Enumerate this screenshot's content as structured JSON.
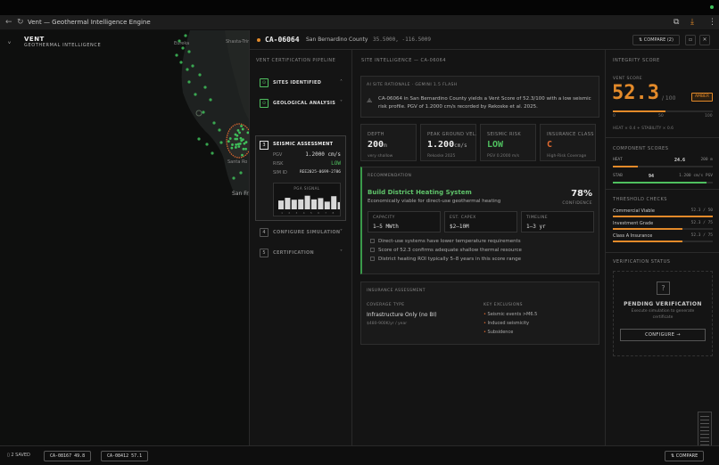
{
  "browser": {
    "title": "Vent — Geothermal Intelligence Engine"
  },
  "brand": {
    "name": "VENT",
    "subtitle": "GEOTHERMAL INTELLIGENCE"
  },
  "map": {
    "labels": [
      "Eureka",
      "Shasta-Trinity National Fore",
      "Santa Ro",
      "San Fr"
    ]
  },
  "site": {
    "id": "CA-06064",
    "county": "San Bernardino County",
    "coords": "35.5000, -116.5009",
    "compare_label": "COMPARE (2)"
  },
  "pipeline": {
    "header": "VENT CERTIFICATION PIPELINE",
    "steps": [
      {
        "label": "SITES IDENTIFIED"
      },
      {
        "label": "GEOLOGICAL ANALYSIS"
      },
      {
        "label": "SEISMIC ASSESSMENT",
        "num": "3"
      },
      {
        "label": "CONFIGURE SIMULATION",
        "num": "4"
      },
      {
        "label": "CERTIFICATION",
        "num": "5"
      }
    ],
    "seismic": {
      "pgv_label": "PGV",
      "pgv_value": "1.2000 cm/s",
      "risk_label": "RISK",
      "risk_value": "LOW",
      "sim_label": "SIM ID",
      "sim_value": "REE2025-0699-2786",
      "pga_title": "PGA SIGNAL",
      "pga_values": [
        0.55,
        0.72,
        0.6,
        0.62,
        0.85,
        0.62,
        0.7,
        0.48,
        0.82,
        0.45
      ],
      "pga_ticks": [
        "1",
        "2",
        "3",
        "4",
        "5",
        "6",
        "7",
        "8"
      ]
    }
  },
  "intel": {
    "header": "SITE INTELLIGENCE — CA-06064",
    "rationale_header": "AI SITE RATIONALE · GEMINI 1.5 FLASH",
    "rationale_text_1": "CA-06064 in San Bernardino County yields a Vent Score of 52.3/100 with a low seismic",
    "rationale_text_2": "risk profile. PGV of 1.2000 cm/s recorded by Rekoske et al. 2025.",
    "metrics": [
      {
        "label": "DEPTH",
        "value": "200",
        "unit": "m",
        "sub": "very shallow",
        "color": "#eeeeee"
      },
      {
        "label": "PEAK GROUND VEL.",
        "value": "1.200",
        "unit": "cm/s",
        "sub": "Rekoske 2025",
        "color": "#eeeeee"
      },
      {
        "label": "SEISMIC RISK",
        "value": "LOW",
        "unit": "",
        "sub": "PGV 0.2000 m/s",
        "color": "#4fbf5f"
      },
      {
        "label": "INSURANCE CLASS",
        "value": "C",
        "unit": "",
        "sub": "High-Risk Coverage",
        "color": "#e0692f"
      }
    ],
    "recommendation": {
      "header": "RECOMMENDATION",
      "title": "Build District Heating System",
      "subtitle": "Economically viable for direct-use geothermal heating",
      "confidence_value": "78%",
      "confidence_label": "CONFIDENCE",
      "stats": [
        {
          "label": "CAPACITY",
          "value": "1–5 MWth"
        },
        {
          "label": "EST. CAPEX",
          "value": "$2–10M"
        },
        {
          "label": "TIMELINE",
          "value": "1–3 yr"
        }
      ],
      "notes": [
        "Direct-use systems have lower temperature requirements",
        "Score of 52.3 confirms adequate shallow thermal resource",
        "District heating ROI typically 5–8 years in this score range"
      ]
    },
    "insurance": {
      "header": "INSURANCE ASSESSMENT",
      "coverage_label": "COVERAGE TYPE",
      "coverage_value": "Infrastructure Only (no BI)",
      "coverage_price": "$480-900K/yr / year",
      "exclusions_label": "KEY EXCLUSIONS",
      "exclusions": [
        "Seismic events >M6.5",
        "Induced seismicity",
        "Subsidence"
      ]
    }
  },
  "integrity": {
    "header": "INTEGRITY SCORE",
    "vent_score_label": "VENT SCORE",
    "score": "52.3",
    "score_fraction": 0.523,
    "score_max": "/ 100",
    "grade": "AMBER",
    "scale": [
      "0",
      "50",
      "100"
    ],
    "breakdown": "HEAT × 0.4 + STABILITY × 0.6",
    "components_header": "COMPONENT SCORES",
    "components": [
      {
        "label": "HEAT",
        "value": "24.6",
        "extra": "200 m",
        "fraction": 0.25
      },
      {
        "label": "STAB",
        "value": "94",
        "extra": "1.200 cm/s PGV",
        "fraction": 0.94
      }
    ],
    "thresholds_header": "THRESHOLD CHECKS",
    "thresholds": [
      {
        "label": "Commercial Viable",
        "value": "52.3 / 50",
        "fraction": 1.0
      },
      {
        "label": "Investment Grade",
        "value": "52.3 / 75",
        "fraction": 0.7
      },
      {
        "label": "Class A Insurance",
        "value": "52.3 / 75",
        "fraction": 0.7
      }
    ],
    "verification_header": "VERIFICATION STATUS",
    "pending_label": "PENDING VERIFICATION",
    "pending_sub_1": "Execute simulation to generate",
    "pending_sub_2": "certificate",
    "configure_label": "CONFIGURE →"
  },
  "bottom": {
    "saved_label": "2 SAVED",
    "chips": [
      "CA-08167 49.8",
      "CA-08412 57.1"
    ],
    "compare_label": "COMPARE"
  },
  "colors": {
    "accent": "#e38a2a",
    "green": "#4fbf5f",
    "orange": "#e0692f",
    "score_bar": "#e38a2a"
  }
}
